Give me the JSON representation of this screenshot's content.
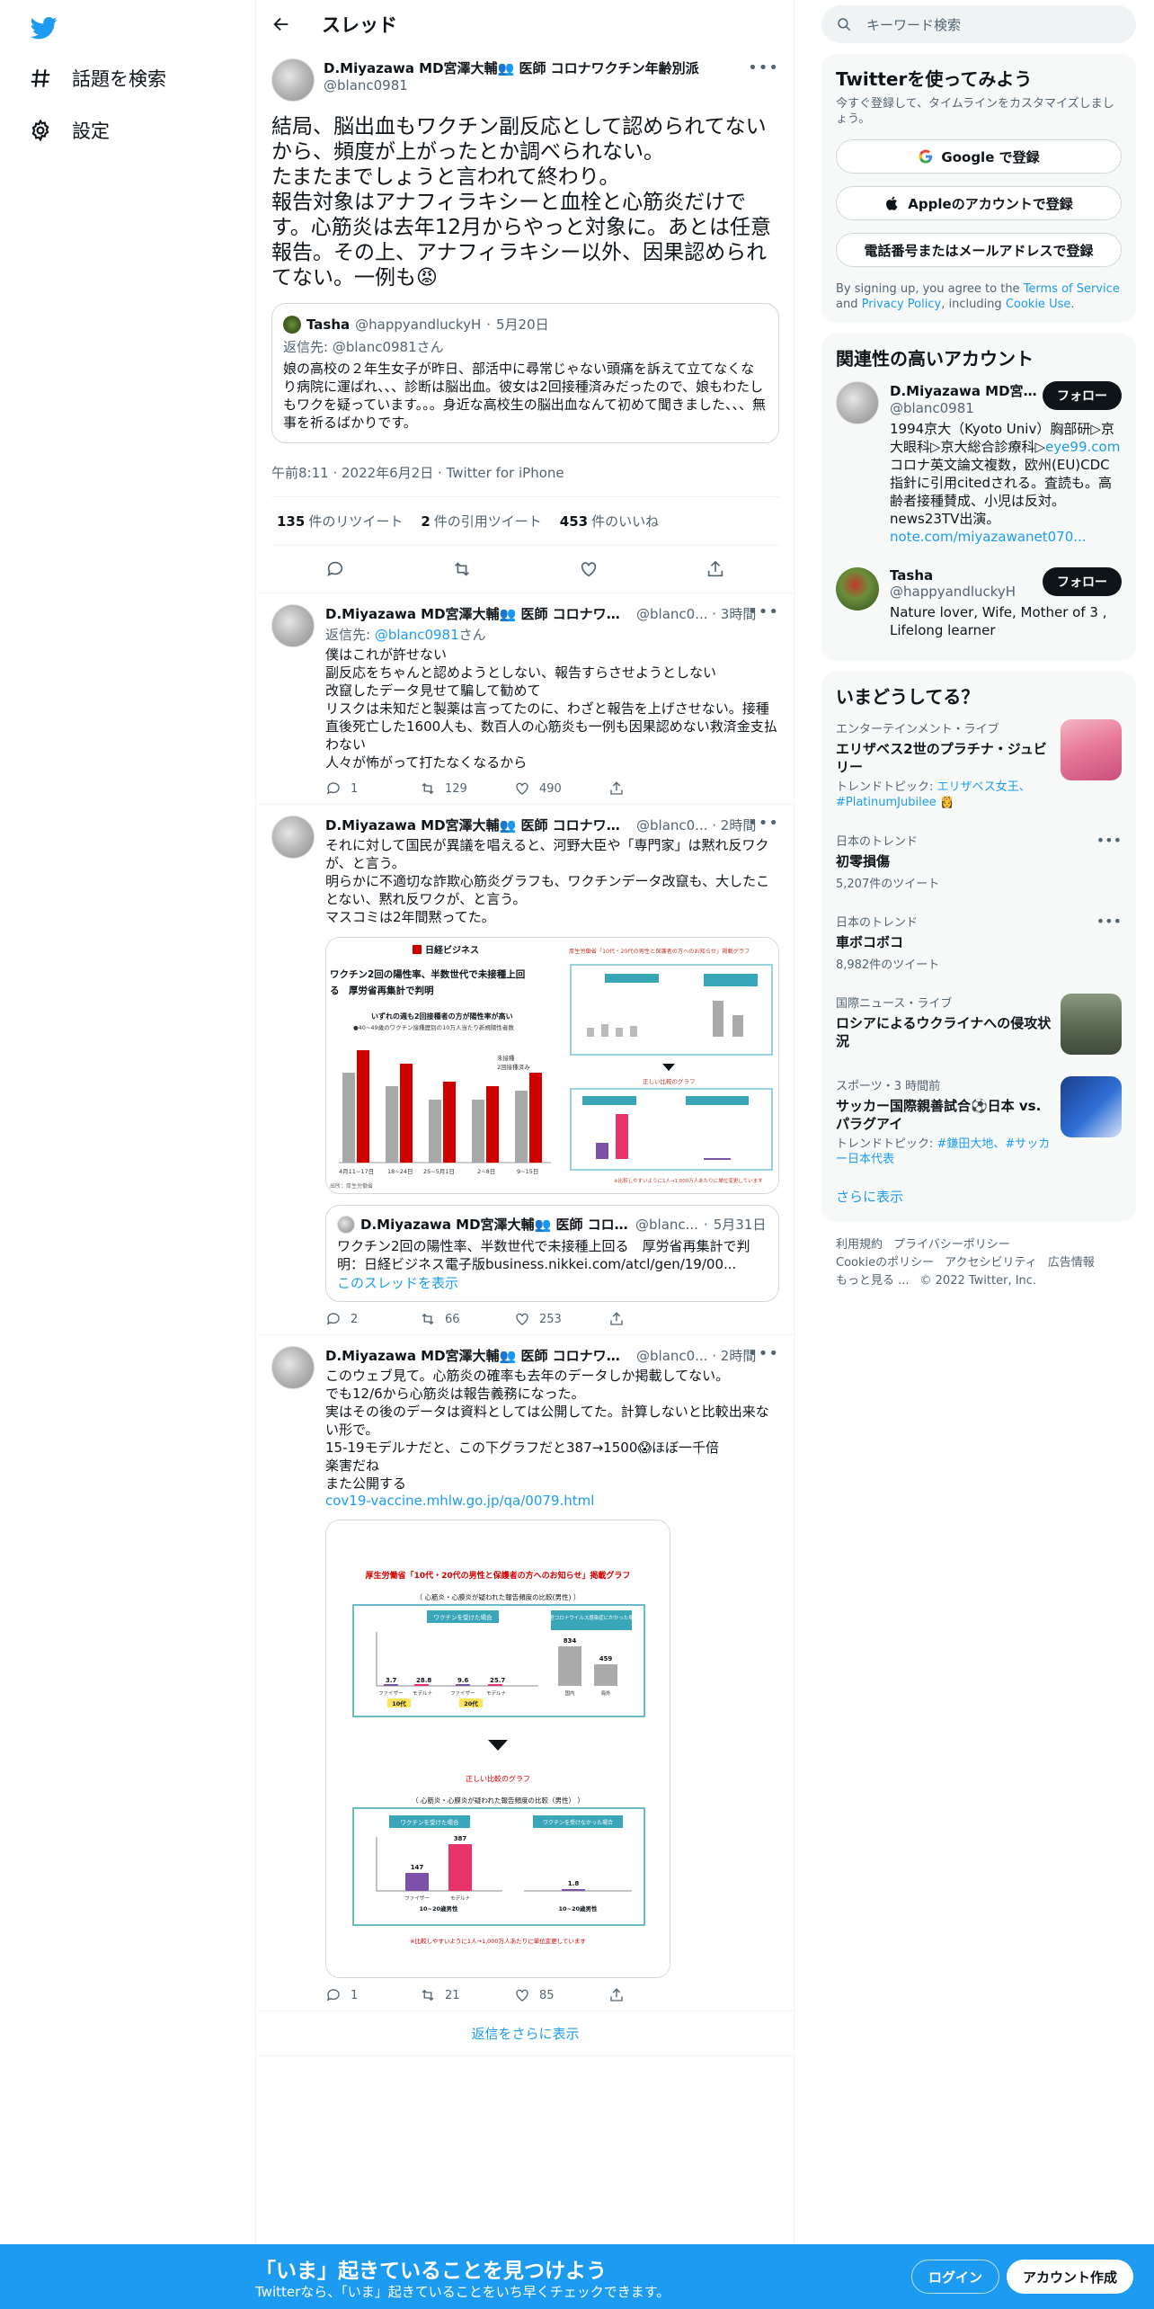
{
  "nav": {
    "explore": "話題を検索",
    "settings": "設定"
  },
  "header": {
    "title": "スレッド"
  },
  "focal": {
    "name": "D.Miyazawa MD宮澤大輔👥 医師 コロナワクチン年齢別派",
    "handle": "@blanc0981",
    "text": "結局、脳出血もワクチン副反応として認められてないから、頻度が上がったとか調べられない。\nたまたまでしょうと言われて終わり。\n報告対象はアナフィラキシーと血栓と心筋炎だけです。心筋炎は去年12月からやっと対象に。あとは任意報告。その上、アナフィラキシー以外、因果認められてない。一例も😡",
    "quote": {
      "name": "Tasha",
      "handle": "@happyandluckyH",
      "date": "5月20日",
      "reply_to_label": "返信先: ",
      "reply_to": "@blanc0981",
      "reply_to_suffix": "さん",
      "text": "娘の高校の２年生女子が昨日、部活中に尋常じゃない頭痛を訴えて立てなくなり病院に運ばれ、、、診断は脳出血。彼女は2回接種済みだったので、娘もわたしもワクを疑っています。。。身近な高校生の脳出血なんて初めて聞きました、、、無事を祈るばかりです。"
    },
    "meta": "午前8:11 · 2022年6月2日 · Twitter for iPhone",
    "retweets": "135",
    "retweets_label": "件のリツイート",
    "quotes": "2",
    "quotes_label": "件の引用ツイート",
    "likes": "453",
    "likes_label": "件のいいね"
  },
  "replies": [
    {
      "name": "D.Miyazawa MD宮澤大輔👥 医師 コロナワクチ...",
      "handle_time": "@blanc0... · 3時間",
      "reply_to_label": "返信先: ",
      "reply_to": "@blanc0981",
      "reply_to_suffix": "さん",
      "text": "僕はこれが許せない\n副反応をちゃんと認めようとしない、報告すらさせようとしない\n改竄したデータ見せて騙して勧めて\nリスクは未知だと製薬は言ってたのに、わざと報告を上げさせない。接種直後死亡した1600人も、数百人の心筋炎も一例も因果認めない救済金支払わない\n人々が怖がって打たなくなるから",
      "replies": "1",
      "retweets": "129",
      "likes": "490"
    },
    {
      "name": "D.Miyazawa MD宮澤大輔👥 医師 コロナワクチ...",
      "handle_time": "@blanc0... · 2時間",
      "text": "それに対して国民が異議を唱えると、河野大臣や「専門家」は黙れ反ワクが、と言う。\n明らかに不適切な詐欺心筋炎グラフも、ワクチンデータ改竄も、大したことない、黙れ反ワクが、と言う。\nマスコミは2年間黙ってた。",
      "quote": {
        "name": "D.Miyazawa MD宮澤大輔👥 医師 コロナワ...",
        "handle": "@blanc...",
        "date": "5月31日",
        "text": "ワクチン2回の陽性率、半数世代で未接種上回る　厚労省再集計で判明：日経ビジネス電子版business.nikkei.com/atcl/gen/19/00...",
        "thread_link": "このスレッドを表示"
      },
      "replies": "2",
      "retweets": "66",
      "likes": "253"
    },
    {
      "name": "D.Miyazawa MD宮澤大輔👥 医師 コロナワクチ...",
      "handle_time": "@blanc0... · 2時間",
      "text": "このウェブ見て。心筋炎の確率も去年のデータしか掲載してない。\nでも12/6から心筋炎は報告義務になった。\n実はその後のデータは資料としては公開してた。計算しないと比較出来ない形で。\n15-19モデルナだと、この下グラフだと387→1500😱ほぼ一千倍\n楽害だね\nまた公開する",
      "link": "cov19-vaccine.mhlw.go.jp/qa/0079.html",
      "replies": "1",
      "retweets": "21",
      "likes": "85"
    }
  ],
  "image1": {
    "brand": "日経ビジネス",
    "title_line1": "ワクチン2回の陽性率、半数世代で未接種上回",
    "title_line2": "る　厚労省再集計で判明",
    "subtitle": "いずれの週も2回接種者の方が陽性率が高い",
    "note": "●40~49歳のワクチン接種歴別の10万人当たり新規陽性者数",
    "legend_a": "未接種",
    "legend_b": "2回接種済み",
    "xlabels": [
      "4月11~17日",
      "18~24日",
      "25~5月1日",
      "2~8日",
      "9~15日"
    ],
    "source": "出所：厚生労働省",
    "right_title": "厚生労働省「10代・20代の男性と保護者の方へのお知らせ」掲載グラフ",
    "right_mid": "正しい比較のグラフ",
    "right_foot": "※比較しやすいように1人→1,000万人あたりに単位変更しています"
  },
  "image2": {
    "title": "厚生労働省「10代・20代の男性と保護者の方へのお知らせ」掲載グラフ",
    "box1_title": "（ 心筋炎・心膜炎が疑われた報告頻度の比較(男性) ）",
    "box1_left_header": "ワクチンを受けた場合",
    "box1_right_header": "新型コロナウイルス感染症にかかった場合",
    "box1_values": [
      "3.7",
      "28.8",
      "9.6",
      "25.7"
    ],
    "box1_right_values": [
      "834",
      "459"
    ],
    "box1_xlabels": [
      "ファイザー",
      "モデルナ",
      "ファイザー",
      "モデルナ"
    ],
    "box1_tags": [
      "10代",
      "20代"
    ],
    "box1_right_xlabels": [
      "国内",
      "海外"
    ],
    "mid_label": "正しい比較のグラフ",
    "box2_title": "（ 心筋炎・心膜炎が疑われた報告頻度の比較（男性） ）",
    "box2_left_header": "ワクチンを受けた場合",
    "box2_right_header": "ワクチンを受けなかった場合",
    "box2_values": [
      "147",
      "387"
    ],
    "box2_right_value": "1.8",
    "box2_xlabels": [
      "ファイザー",
      "モデルナ"
    ],
    "box2_age": "10~20歳男性",
    "foot": "※比較しやすいように1人→1,000万人あたりに単位変更しています"
  },
  "show_more_replies": "返信をさらに表示",
  "right": {
    "search_placeholder": "キーワード検索",
    "signup_title": "Twitterを使ってみよう",
    "signup_sub": "今すぐ登録して、タイムラインをカスタマイズしましょう。",
    "google_btn": "Google で登録",
    "apple_btn": "Appleのアカウントで登録",
    "phone_btn": "電話番号またはメールアドレスで登録",
    "legal_pre": "By signing up, you agree to the ",
    "legal_tos": "Terms of Service",
    "legal_and": " and ",
    "legal_privacy": "Privacy Policy",
    "legal_incl": ", including ",
    "legal_cookie": "Cookie Use",
    "legal_end": ".",
    "related_title": "関連性の高いアカウント",
    "accounts": [
      {
        "name": "D.Miyazawa MD宮澤...",
        "handle": "@blanc0981",
        "follow": "フォロー",
        "bio_pre": "1994京大（Kyoto Univ）胸部研▷京大眼科▷京大総合診療科▷",
        "bio_link1": "eye99.com",
        "bio_mid": " コロナ英文論文複数，欧州(EU)CDC指針に引用citedされる。査読も。高齢者接種賛成、小児は反対。news23TV出演。",
        "bio_link2": "note.com/miyazawanet070..."
      },
      {
        "name": "Tasha",
        "handle": "@happyandluckyH",
        "follow": "フォロー",
        "bio_pre": "Nature lover, Wife, Mother of 3 , Lifelong learner"
      }
    ],
    "trends_title": "いまどうしてる？",
    "trends": [
      {
        "category": "エンターテインメント・ライブ",
        "name": "エリザベス2世のプラチナ・ジュビリー",
        "topic_label": "トレンドトピック: ",
        "topic": "エリザベス女王、#PlatinumJubilee 👸"
      },
      {
        "category": "日本のトレンド",
        "name": "初零損傷",
        "count": "5,207件のツイート"
      },
      {
        "category": "日本のトレンド",
        "name": "車ボコボコ",
        "count": "8,982件のツイート"
      },
      {
        "category": "国際ニュース・ライブ",
        "name": "ロシアによるウクライナへの侵攻状況"
      },
      {
        "category": "スポーツ・3 時間前",
        "name": "サッカー国際親善試合⚽日本 vs. パラグアイ",
        "topic_label": "トレンドトピック: ",
        "topic": "#鎌田大地、#サッカー日本代表"
      }
    ],
    "show_all": "さらに表示",
    "footer_links": [
      "利用規約",
      "プライバシーポリシー",
      "Cookieのポリシー",
      "アクセシビリティ",
      "広告情報",
      "もっと見る ...",
      "© 2022 Twitter, Inc."
    ]
  },
  "banner": {
    "title": "「いま」起きていることを見つけよう",
    "subtitle": "Twitterなら、「いま」起きていることをいち早くチェックできます。",
    "login": "ログイン",
    "signup": "アカウント作成"
  },
  "colors": {
    "accent": "#1d9bf0",
    "banner": "#1d9bf0",
    "nikkei_red": "#d10000",
    "teal": "#3aa6b9"
  }
}
